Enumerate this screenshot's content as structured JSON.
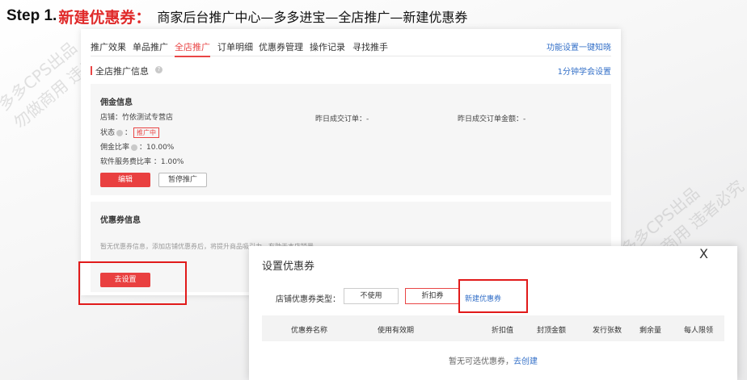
{
  "header": {
    "step": "Step 1.",
    "step_title": "新建优惠券：",
    "path": "商家后台推广中心—多多进宝—全店推广—新建优惠券"
  },
  "watermark": {
    "line1": "多多CPS出品",
    "line2": "勿做商用 违者必究"
  },
  "nav": {
    "tabs": [
      "推广效果",
      "单品推广",
      "全店推广",
      "订单明细",
      "优惠券管理",
      "操作记录",
      "寻找推手"
    ],
    "active_index": 2,
    "right_link": "功能设置一键知晓"
  },
  "section": {
    "title": "全店推广信息",
    "help_link": "1分钟学会设置"
  },
  "commission": {
    "heading": "佣金信息",
    "store_label": "店铺：",
    "store_value": "竹依测试专营店",
    "yesterday_orders_label": "昨日成交订单：",
    "yesterday_orders_value": "-",
    "yesterday_amount_label": "昨日成交订单金额：",
    "yesterday_amount_value": "-",
    "status_label": "状态",
    "status_value": "推广中",
    "rate_label": "佣金比率",
    "rate_value": "10.00%",
    "service_label": "软件服务费比率 ：",
    "service_value": "1.00%",
    "edit_button": "编辑",
    "pause_button": "暂停推广"
  },
  "coupon": {
    "heading": "优惠券信息",
    "empty_text": "暂无优惠券信息，添加店铺优惠券后，将提升商品吸引力，有助于本店销量",
    "set_button": "去设置"
  },
  "dialog": {
    "title": "设置优惠券",
    "close": "X",
    "type_label": "店铺优惠券类型：",
    "options": [
      "不使用",
      "折扣券"
    ],
    "selected_option": "折扣券",
    "new_coupon_link": "新建优惠券",
    "columns": [
      "优惠券名称",
      "使用有效期",
      "折扣值",
      "封顶金额",
      "发行张数",
      "剩余量",
      "每人限领"
    ],
    "empty_prefix": "暂无可选优惠券，",
    "empty_link": "去创建"
  },
  "colors": {
    "accent_red": "#e94040",
    "link_blue": "#3470c8",
    "highlight_red": "#e11a1a"
  }
}
